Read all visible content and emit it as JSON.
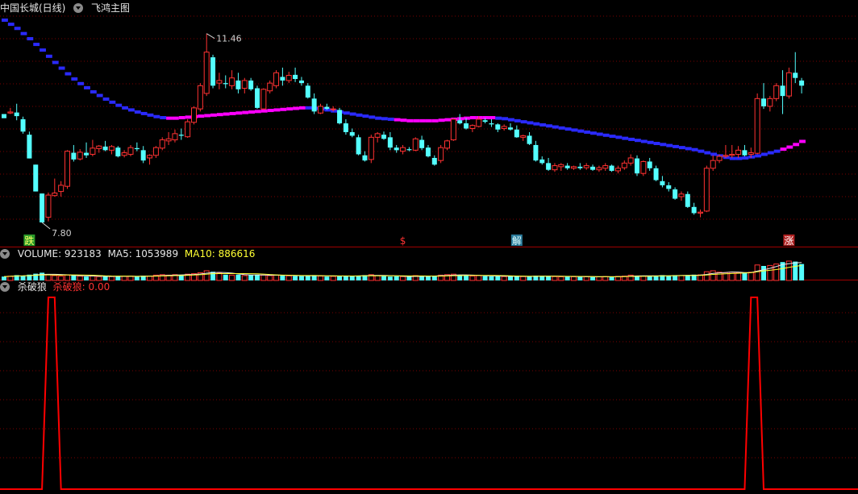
{
  "main_header": {
    "stock_title": "中国长城(日线)",
    "indicator_name": "飞鸿主图",
    "collapse_icon": "chevron-down-icon"
  },
  "volume_header": {
    "volume_label": "VOLUME: 923183",
    "ma5_label": "MA5: 1053989",
    "ma10_label": "MA10: 886616"
  },
  "osc_header": {
    "title": "杀破狼",
    "value_label": "杀破狼: 0.00"
  },
  "colors": {
    "background": "#000000",
    "up": "#ff3232",
    "down": "#54ffff",
    "ma_blue": "#2a2aff",
    "ma_magenta": "#ff00ff",
    "grid": "#7a0000",
    "separator": "#a00000",
    "oscillator": "#ff0000",
    "ma10_text": "#ffff33"
  },
  "chart_data": [
    {
      "type": "candlestick",
      "name": "price",
      "annotations": [
        {
          "text": "11.46",
          "type": "high"
        },
        {
          "text": "7.80",
          "type": "low"
        }
      ],
      "signals": [
        {
          "text": "跌",
          "index": 4
        },
        {
          "text": "$",
          "index": 63
        },
        {
          "text": "解",
          "index": 81
        },
        {
          "text": "涨",
          "index": 124
        }
      ],
      "candles": [
        [
          9.9,
          9.9,
          9.82,
          9.82
        ],
        [
          9.92,
          10.02,
          9.9,
          9.94
        ],
        [
          9.93,
          10.1,
          9.78,
          9.86
        ],
        [
          9.8,
          9.85,
          9.52,
          9.56
        ],
        [
          9.5,
          9.56,
          9.04,
          9.04
        ],
        [
          8.92,
          8.92,
          8.4,
          8.4
        ],
        [
          8.36,
          8.36,
          7.8,
          7.8
        ],
        [
          7.9,
          8.38,
          7.82,
          8.33
        ],
        [
          8.32,
          8.65,
          8.3,
          8.37
        ],
        [
          8.4,
          8.6,
          8.3,
          8.52
        ],
        [
          8.5,
          9.2,
          8.45,
          9.18
        ],
        [
          9.15,
          9.3,
          8.98,
          9.02
        ],
        [
          9.03,
          9.22,
          9.0,
          9.16
        ],
        [
          9.15,
          9.35,
          9.05,
          9.1
        ],
        [
          9.12,
          9.4,
          9.08,
          9.24
        ],
        [
          9.23,
          9.3,
          9.15,
          9.28
        ],
        [
          9.27,
          9.38,
          9.18,
          9.2
        ],
        [
          9.2,
          9.3,
          9.12,
          9.27
        ],
        [
          9.25,
          9.28,
          9.06,
          9.08
        ],
        [
          9.1,
          9.2,
          9.06,
          9.15
        ],
        [
          9.12,
          9.3,
          9.08,
          9.25
        ],
        [
          9.24,
          9.35,
          9.18,
          9.22
        ],
        [
          9.2,
          9.28,
          8.95,
          9.0
        ],
        [
          9.05,
          9.12,
          8.92,
          9.1
        ],
        [
          9.1,
          9.28,
          9.05,
          9.25
        ],
        [
          9.24,
          9.45,
          9.2,
          9.4
        ],
        [
          9.38,
          9.55,
          9.3,
          9.42
        ],
        [
          9.4,
          9.6,
          9.35,
          9.52
        ],
        [
          9.5,
          9.62,
          9.4,
          9.48
        ],
        [
          9.46,
          9.8,
          9.44,
          9.75
        ],
        [
          9.74,
          10.05,
          9.7,
          10.02
        ],
        [
          10.0,
          10.5,
          9.95,
          10.45
        ],
        [
          10.3,
          11.46,
          10.25,
          11.1
        ],
        [
          11.0,
          11.05,
          10.4,
          10.45
        ],
        [
          10.5,
          10.7,
          10.38,
          10.55
        ],
        [
          10.5,
          10.65,
          10.4,
          10.48
        ],
        [
          10.45,
          10.75,
          10.38,
          10.6
        ],
        [
          10.55,
          10.7,
          10.3,
          10.38
        ],
        [
          10.4,
          10.6,
          10.3,
          10.55
        ],
        [
          10.55,
          10.6,
          10.35,
          10.38
        ],
        [
          10.4,
          10.45,
          10.0,
          10.02
        ],
        [
          10.0,
          10.4,
          9.98,
          10.38
        ],
        [
          10.35,
          10.55,
          10.3,
          10.5
        ],
        [
          10.45,
          10.75,
          10.4,
          10.7
        ],
        [
          10.62,
          10.8,
          10.45,
          10.55
        ],
        [
          10.55,
          10.72,
          10.5,
          10.65
        ],
        [
          10.66,
          10.8,
          10.52,
          10.58
        ],
        [
          10.55,
          10.62,
          10.45,
          10.5
        ],
        [
          10.45,
          10.5,
          10.2,
          10.22
        ],
        [
          10.2,
          10.3,
          9.9,
          9.95
        ],
        [
          9.92,
          10.1,
          9.9,
          10.05
        ],
        [
          10.04,
          10.1,
          9.98,
          10.0
        ],
        [
          10.0,
          10.05,
          9.95,
          10.0
        ],
        [
          9.98,
          10.02,
          9.7,
          9.72
        ],
        [
          9.72,
          9.8,
          9.5,
          9.55
        ],
        [
          9.55,
          9.62,
          9.45,
          9.48
        ],
        [
          9.45,
          9.5,
          9.1,
          9.12
        ],
        [
          9.1,
          9.18,
          8.98,
          9.0
        ],
        [
          9.02,
          9.5,
          8.95,
          9.45
        ],
        [
          9.45,
          9.55,
          9.35,
          9.52
        ],
        [
          9.5,
          9.56,
          9.4,
          9.42
        ],
        [
          9.45,
          9.55,
          9.2,
          9.25
        ],
        [
          9.25,
          9.3,
          9.15,
          9.2
        ],
        [
          9.18,
          9.3,
          9.12,
          9.25
        ],
        [
          9.22,
          9.26,
          9.18,
          9.2
        ],
        [
          9.2,
          9.45,
          9.18,
          9.42
        ],
        [
          9.4,
          9.48,
          9.2,
          9.24
        ],
        [
          9.25,
          9.3,
          9.06,
          9.08
        ],
        [
          9.05,
          9.1,
          8.9,
          8.92
        ],
        [
          9.0,
          9.3,
          8.95,
          9.25
        ],
        [
          9.24,
          9.4,
          9.2,
          9.38
        ],
        [
          9.4,
          9.82,
          9.38,
          9.8
        ],
        [
          9.78,
          9.9,
          9.7,
          9.72
        ],
        [
          9.72,
          9.82,
          9.6,
          9.62
        ],
        [
          9.62,
          9.7,
          9.55,
          9.68
        ],
        [
          9.66,
          9.86,
          9.64,
          9.8
        ],
        [
          9.78,
          9.82,
          9.72,
          9.75
        ],
        [
          9.72,
          9.8,
          9.65,
          9.7
        ],
        [
          9.7,
          9.72,
          9.55,
          9.6
        ],
        [
          9.62,
          9.7,
          9.58,
          9.66
        ],
        [
          9.64,
          9.72,
          9.58,
          9.6
        ],
        [
          9.6,
          9.68,
          9.44,
          9.45
        ],
        [
          9.45,
          9.5,
          9.38,
          9.48
        ],
        [
          9.48,
          9.55,
          9.3,
          9.32
        ],
        [
          9.3,
          9.38,
          8.98,
          9.0
        ],
        [
          9.02,
          9.08,
          8.92,
          8.95
        ],
        [
          8.95,
          9.05,
          8.8,
          8.82
        ],
        [
          8.82,
          8.95,
          8.78,
          8.9
        ],
        [
          8.88,
          8.95,
          8.8,
          8.92
        ],
        [
          8.9,
          8.95,
          8.82,
          8.85
        ],
        [
          8.85,
          8.9,
          8.82,
          8.88
        ],
        [
          8.88,
          8.95,
          8.82,
          8.85
        ],
        [
          8.86,
          8.95,
          8.82,
          8.9
        ],
        [
          8.88,
          8.92,
          8.8,
          8.82
        ],
        [
          8.82,
          8.9,
          8.78,
          8.86
        ],
        [
          8.85,
          8.95,
          8.8,
          8.9
        ],
        [
          8.9,
          8.92,
          8.78,
          8.8
        ],
        [
          8.8,
          8.9,
          8.75,
          8.85
        ],
        [
          8.86,
          9.0,
          8.82,
          8.95
        ],
        [
          8.95,
          9.12,
          8.9,
          9.05
        ],
        [
          9.04,
          9.1,
          8.7,
          8.75
        ],
        [
          8.75,
          9.0,
          8.7,
          8.98
        ],
        [
          8.98,
          9.05,
          8.8,
          8.85
        ],
        [
          8.85,
          8.9,
          8.6,
          8.62
        ],
        [
          8.6,
          8.7,
          8.48,
          8.52
        ],
        [
          8.52,
          8.58,
          8.4,
          8.45
        ],
        [
          8.44,
          8.48,
          8.24,
          8.26
        ],
        [
          8.3,
          8.4,
          8.22,
          8.35
        ],
        [
          8.35,
          8.4,
          8.08,
          8.1
        ],
        [
          8.1,
          8.18,
          7.95,
          7.98
        ],
        [
          7.98,
          8.05,
          7.9,
          8.0
        ],
        [
          8.02,
          8.9,
          8.0,
          8.85
        ],
        [
          8.85,
          9.1,
          8.8,
          9.0
        ],
        [
          9.0,
          9.12,
          8.95,
          9.08
        ],
        [
          9.08,
          9.3,
          9.05,
          9.1
        ],
        [
          9.1,
          9.3,
          9.05,
          9.12
        ],
        [
          9.12,
          9.28,
          9.05,
          9.2
        ],
        [
          9.2,
          9.3,
          9.08,
          9.1
        ],
        [
          9.12,
          9.25,
          9.05,
          9.15
        ],
        [
          9.14,
          10.3,
          9.12,
          10.2
        ],
        [
          10.2,
          10.5,
          10.0,
          10.05
        ],
        [
          10.05,
          10.25,
          9.95,
          10.2
        ],
        [
          10.2,
          10.5,
          10.15,
          10.45
        ],
        [
          10.45,
          10.75,
          9.9,
          10.25
        ],
        [
          10.25,
          10.8,
          10.2,
          10.7
        ],
        [
          10.7,
          11.1,
          10.5,
          10.6
        ],
        [
          10.55,
          10.6,
          10.3,
          10.45
        ]
      ],
      "ma_line": [
        11.72,
        11.64,
        11.56,
        11.46,
        11.36,
        11.25,
        11.14,
        11.02,
        10.9,
        10.79,
        10.68,
        10.58,
        10.49,
        10.41,
        10.33,
        10.26,
        10.19,
        10.13,
        10.07,
        10.02,
        9.98,
        9.94,
        9.91,
        9.88,
        9.85,
        9.83,
        9.82,
        9.82,
        9.83,
        9.84,
        9.85,
        9.86,
        9.87,
        9.88,
        9.89,
        9.9,
        9.91,
        9.92,
        9.93,
        9.94,
        9.95,
        9.96,
        9.97,
        9.98,
        9.99,
        10.0,
        10.01,
        10.02,
        10.02,
        10.01,
        10.0,
        9.98,
        9.96,
        9.94,
        9.92,
        9.9,
        9.88,
        9.86,
        9.84,
        9.82,
        9.81,
        9.8,
        9.79,
        9.78,
        9.77,
        9.77,
        9.77,
        9.77,
        9.77,
        9.78,
        9.79,
        9.8,
        9.81,
        9.82,
        9.83,
        9.83,
        9.83,
        9.83,
        9.82,
        9.81,
        9.79,
        9.77,
        9.75,
        9.73,
        9.71,
        9.69,
        9.67,
        9.65,
        9.63,
        9.61,
        9.59,
        9.57,
        9.55,
        9.53,
        9.51,
        9.49,
        9.47,
        9.45,
        9.43,
        9.41,
        9.39,
        9.37,
        9.35,
        9.33,
        9.31,
        9.29,
        9.27,
        9.25,
        9.23,
        9.21,
        9.18,
        9.15,
        9.12,
        9.09,
        9.06,
        9.04,
        9.04,
        9.05,
        9.07,
        9.09,
        9.12,
        9.15,
        9.18,
        9.22,
        9.26,
        9.31,
        9.37,
        9.44,
        9.52,
        9.6,
        9.68,
        9.76
      ],
      "ma_trend": [
        1,
        1,
        1,
        1,
        1,
        1,
        1,
        1,
        1,
        1,
        1,
        1,
        1,
        1,
        1,
        1,
        1,
        1,
        1,
        1,
        1,
        1,
        1,
        1,
        1,
        1,
        0,
        0,
        0,
        0,
        0,
        0,
        0,
        0,
        0,
        0,
        0,
        0,
        0,
        0,
        0,
        0,
        0,
        0,
        0,
        0,
        0,
        0,
        1,
        1,
        1,
        1,
        1,
        1,
        1,
        1,
        1,
        1,
        1,
        1,
        1,
        1,
        0,
        0,
        0,
        0,
        0,
        0,
        0,
        0,
        0,
        0,
        0,
        0,
        0,
        0,
        0,
        0,
        1,
        1,
        1,
        1,
        1,
        1,
        1,
        1,
        1,
        1,
        1,
        1,
        1,
        1,
        1,
        1,
        1,
        1,
        1,
        1,
        1,
        1,
        1,
        1,
        1,
        1,
        1,
        1,
        1,
        1,
        1,
        1,
        1,
        1,
        1,
        1,
        1,
        1,
        1,
        1,
        1,
        1,
        1,
        1,
        1,
        0,
        0,
        0,
        0,
        0,
        0,
        0,
        0,
        0,
        0,
        0,
        0,
        0,
        0,
        0,
        0,
        0
      ]
    },
    {
      "type": "bar",
      "name": "volume",
      "values": [
        0.4,
        0.45,
        0.55,
        0.5,
        0.6,
        0.7,
        0.8,
        0.6,
        0.5,
        0.45,
        0.55,
        0.5,
        0.45,
        0.4,
        0.45,
        0.4,
        0.45,
        0.4,
        0.45,
        0.42,
        0.45,
        0.4,
        0.5,
        0.45,
        0.55,
        0.6,
        0.55,
        0.6,
        0.58,
        0.65,
        0.7,
        0.8,
        1.0,
        0.9,
        0.75,
        0.6,
        0.55,
        0.6,
        0.5,
        0.55,
        0.6,
        0.55,
        0.5,
        0.55,
        0.5,
        0.48,
        0.45,
        0.45,
        0.5,
        0.55,
        0.45,
        0.4,
        0.42,
        0.45,
        0.5,
        0.45,
        0.5,
        0.55,
        0.6,
        0.5,
        0.45,
        0.4,
        0.42,
        0.4,
        0.38,
        0.5,
        0.45,
        0.45,
        0.5,
        0.55,
        0.6,
        0.65,
        0.55,
        0.5,
        0.45,
        0.5,
        0.45,
        0.42,
        0.45,
        0.4,
        0.42,
        0.45,
        0.4,
        0.42,
        0.5,
        0.45,
        0.45,
        0.4,
        0.38,
        0.4,
        0.38,
        0.4,
        0.38,
        0.36,
        0.38,
        0.4,
        0.4,
        0.42,
        0.45,
        0.55,
        0.5,
        0.45,
        0.42,
        0.5,
        0.55,
        0.5,
        0.55,
        0.5,
        0.55,
        0.6,
        0.58,
        0.9,
        1.0,
        0.85,
        0.8,
        0.85,
        0.8,
        0.75,
        0.85,
        1.6,
        1.5,
        1.55,
        1.7,
        1.9,
        2.0,
        1.95,
        1.7
      ]
    },
    {
      "type": "line",
      "name": "杀破狼",
      "x": [
        0,
        6,
        7,
        8,
        9,
        117,
        118,
        119,
        120,
        128
      ],
      "values": [
        0,
        0,
        100,
        100,
        0,
        0,
        100,
        100,
        0,
        0
      ],
      "ylim": [
        0,
        100
      ]
    }
  ]
}
